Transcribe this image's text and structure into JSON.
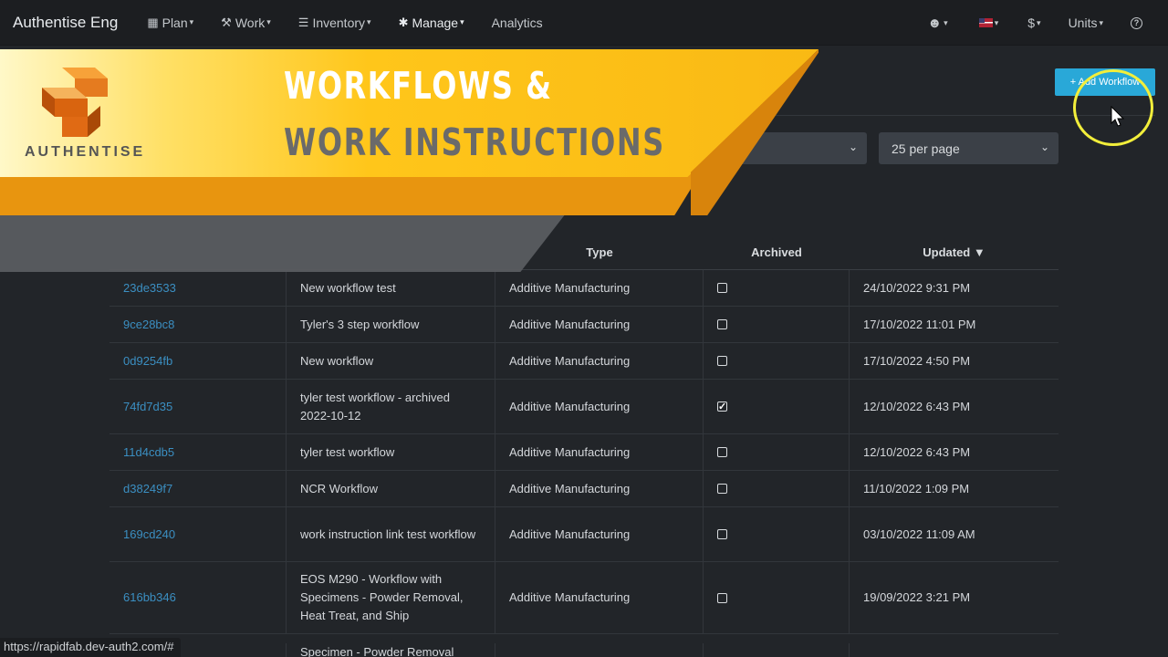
{
  "nav": {
    "brand": "Authentise Eng",
    "items": [
      {
        "label": "Plan",
        "icon": "calendar-icon",
        "glyph": "▦"
      },
      {
        "label": "Work",
        "icon": "wrench-icon",
        "glyph": "🔧"
      },
      {
        "label": "Inventory",
        "icon": "list-icon",
        "glyph": "☰"
      },
      {
        "label": "Manage",
        "icon": "gear-icon",
        "glyph": "✱"
      },
      {
        "label": "Analytics",
        "icon": "",
        "glyph": ""
      }
    ],
    "right": {
      "user_icon": "user-icon",
      "flag_icon": "us-flag-icon",
      "currency_label": "$",
      "units_label": "Units",
      "help_icon": "help-icon"
    }
  },
  "banner": {
    "line1": "WORKFLOWS &",
    "line2": "WORK INSTRUCTIONS",
    "logo_text": "AUTHENTISE"
  },
  "toolbar": {
    "add_button_label": "+ Add Workflow",
    "per_page_value": "25 per page"
  },
  "table": {
    "columns": {
      "type": "Type",
      "archived": "Archived",
      "updated": "Updated ▼"
    },
    "rows": [
      {
        "id": "23de3533",
        "name": "New workflow test",
        "type": "Additive Manufacturing",
        "archived": false,
        "updated": "24/10/2022 9:31 PM"
      },
      {
        "id": "9ce28bc8",
        "name": "Tyler's 3 step workflow",
        "type": "Additive Manufacturing",
        "archived": false,
        "updated": "17/10/2022 11:01 PM"
      },
      {
        "id": "0d9254fb",
        "name": "New workflow",
        "type": "Additive Manufacturing",
        "archived": false,
        "updated": "17/10/2022 4:50 PM"
      },
      {
        "id": "74fd7d35",
        "name": "tyler test workflow - archived 2022-10-12",
        "type": "Additive Manufacturing",
        "archived": true,
        "updated": "12/10/2022 6:43 PM"
      },
      {
        "id": "11d4cdb5",
        "name": "tyler test workflow",
        "type": "Additive Manufacturing",
        "archived": false,
        "updated": "12/10/2022 6:43 PM"
      },
      {
        "id": "d38249f7",
        "name": "NCR Workflow",
        "type": "Additive Manufacturing",
        "archived": false,
        "updated": "11/10/2022 1:09 PM"
      },
      {
        "id": "169cd240",
        "name": "work instruction link test workflow",
        "type": "Additive Manufacturing",
        "archived": false,
        "updated": "03/10/2022 11:09 AM"
      },
      {
        "id": "616bb346",
        "name": "EOS M290 - Workflow with Specimens - Powder Removal, Heat Treat, and Ship",
        "type": "Additive Manufacturing",
        "archived": false,
        "updated": "19/09/2022 3:21 PM"
      },
      {
        "id": "",
        "name": "Specimen - Powder Removal",
        "type": "",
        "archived": null,
        "updated": ""
      }
    ]
  },
  "status_bar": {
    "url": "https://rapidfab.dev-auth2.com/#"
  },
  "colors": {
    "nav_bg": "#1c1e21",
    "page_bg": "#222529",
    "link": "#3b8fc2",
    "accent_button": "#29a8d8",
    "banner_yellow": "#ffc61a",
    "banner_orange": "#e8950f",
    "highlight_ring": "#f2ee3b"
  }
}
